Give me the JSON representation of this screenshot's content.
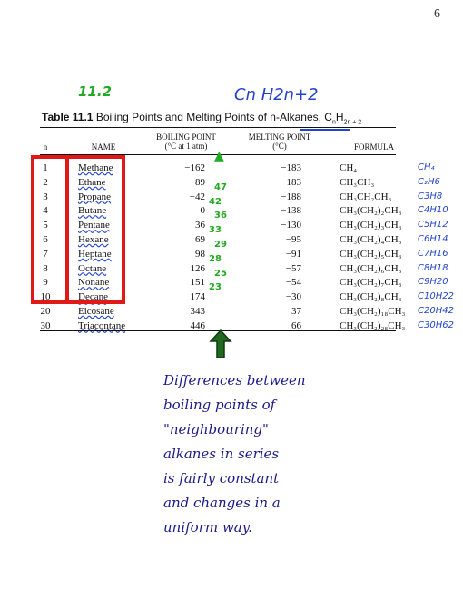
{
  "page_number": "6",
  "annotations": {
    "section_number": "11.2",
    "general_formula": "Cn H2n+2"
  },
  "table": {
    "label": "Table 11.1",
    "caption": "Boiling Points and Melting Points of n-Alkanes, C",
    "caption_sub_n": "n",
    "caption_mid": "H",
    "caption_sub_2n2": "2n + 2",
    "headers": {
      "n": "n",
      "name": "NAME",
      "bp": "BOILING POINT",
      "bp_unit": "(°C at 1 atm)",
      "mp": "MELTING POINT",
      "mp_unit": "(°C)",
      "formula": "FORMULA"
    },
    "rows": [
      {
        "n": "1",
        "name": "Methane",
        "bp": "−162",
        "mp": "−183",
        "formula": "CH₄",
        "hw": "CH₄"
      },
      {
        "n": "2",
        "name": "Ethane",
        "bp": "−89",
        "mp": "−183",
        "formula": "CH₃CH₃",
        "hw": "C₂H6"
      },
      {
        "n": "3",
        "name": "Propane",
        "bp": "−42",
        "mp": "−188",
        "formula": "CH₃CH₂CH₃",
        "hw": "C3H8"
      },
      {
        "n": "4",
        "name": "Butane",
        "bp": "0",
        "mp": "−138",
        "formula": "CH₃(CH₂)₂CH₃",
        "hw": "C4H10"
      },
      {
        "n": "5",
        "name": "Pentane",
        "bp": "36",
        "mp": "−130",
        "formula": "CH₃(CH₂)₃CH₃",
        "hw": "C5H12"
      },
      {
        "n": "6",
        "name": "Hexane",
        "bp": "69",
        "mp": "−95",
        "formula": "CH₃(CH₂)₄CH₃",
        "hw": "C6H14"
      },
      {
        "n": "7",
        "name": "Heptane",
        "bp": "98",
        "mp": "−91",
        "formula": "CH₃(CH₂)₅CH₃",
        "hw": "C7H16"
      },
      {
        "n": "8",
        "name": "Octane",
        "bp": "126",
        "mp": "−57",
        "formula": "CH₃(CH₂)₆CH₃",
        "hw": "C8H18"
      },
      {
        "n": "9",
        "name": "Nonane",
        "bp": "151",
        "mp": "−54",
        "formula": "CH₃(CH₂)₇CH₃",
        "hw": "C9H20"
      },
      {
        "n": "10",
        "name": "Decane",
        "bp": "174",
        "mp": "−30",
        "formula": "CH₃(CH₂)₈CH₃",
        "hw": "C10H22"
      },
      {
        "n": "20",
        "name": "Eicosane",
        "bp": "343",
        "mp": "37",
        "formula": "CH₃(CH₂)₁₈CH₃",
        "hw": "C20H42"
      },
      {
        "n": "30",
        "name": "Triacontane",
        "bp": "446",
        "mp": "66",
        "formula": "CH₃(CH₂)₂₈CH₃",
        "hw": "C30H62"
      }
    ],
    "differences": [
      "47",
      "42",
      "36",
      "33",
      "29",
      "28",
      "25",
      "23"
    ]
  },
  "note_lines": [
    "Differences between",
    "boiling points of",
    "\"neighbouring\"",
    "alkanes in series",
    "is fairly constant",
    "and changes in a",
    "uniform way."
  ],
  "colors": {
    "red_box": "#e01818",
    "handwriting_blue": "#2244cc",
    "handwriting_green": "#22aa22",
    "handwriting_navy": "#1a1a8a"
  }
}
